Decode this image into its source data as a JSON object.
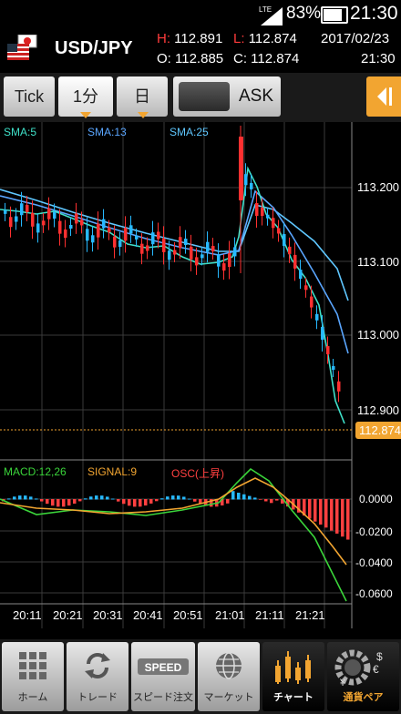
{
  "status": {
    "battery": "83%",
    "time": "21:30",
    "network": "LTE"
  },
  "header": {
    "pair": "USD/JPY",
    "high_label": "H:",
    "high": "112.891",
    "low_label": "L:",
    "low": "112.874",
    "open_label": "O:",
    "open": "112.885",
    "close_label": "C:",
    "close": "112.874",
    "date": "2017/02/23",
    "time": "21:30"
  },
  "tabs": {
    "tick": "Tick",
    "minute": "1分",
    "day": "日",
    "ask": "ASK"
  },
  "indicators": {
    "sma5": "SMA:5",
    "sma13": "SMA:13",
    "sma25": "SMA:25",
    "macd": "MACD:12,26",
    "signal": "SIGNAL:9",
    "osc": "OSC(上昇)",
    "colors": {
      "sma5": "#3fe0c8",
      "sma13": "#5aa6ff",
      "sma25": "#5fc7ff",
      "macd": "#3ad43a",
      "signal": "#f2a531",
      "osc": "#ff4040",
      "up": "#27b9ff",
      "down": "#ff3030",
      "current": "#f2a531"
    }
  },
  "chart_data": {
    "type": "candlestick",
    "price_ticks": [
      "113.200",
      "113.100",
      "113.000",
      "112.900"
    ],
    "current_price": "112.874",
    "time_ticks": [
      "20:11",
      "20:21",
      "20:31",
      "20:41",
      "20:51",
      "21:01",
      "21:11",
      "21:21"
    ],
    "macd_ticks": [
      "0.0000",
      "-0.0200",
      "-0.0400",
      "-0.0600"
    ]
  },
  "footer": {
    "home": "ホーム",
    "trade": "トレード",
    "speed": "スピード注文",
    "market": "マーケット",
    "chart": "チャート",
    "pairs": "通貨ペア"
  }
}
